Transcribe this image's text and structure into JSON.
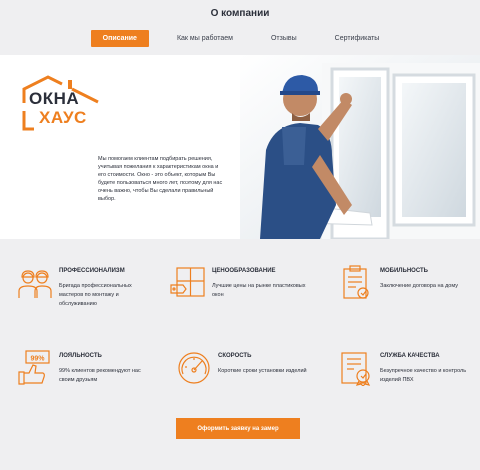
{
  "title": "О компании",
  "tabs": [
    {
      "label": "Описание",
      "active": true
    },
    {
      "label": "Как мы работаем",
      "active": false
    },
    {
      "label": "Отзывы",
      "active": false
    },
    {
      "label": "Сертификаты",
      "active": false
    }
  ],
  "logo": {
    "line1": "ОКНА",
    "line2": "ХАУС"
  },
  "about_text": "Мы помогаем клиентам подбирать решения, учитывая пожелания к характеристикам окна и его стоимости. Окно - это объект, которым Вы будете пользоваться много лет, поэтому для нас очень важно, чтобы Вы сделали правильный выбор.",
  "features": [
    {
      "title": "ПРОФЕССИОНАЛИЗМ",
      "description": "Бригада профессиональных мастеров по монтажу и обслуживанию",
      "icon": "workers-icon"
    },
    {
      "title": "ЦЕНООБРАЗОВАНИЕ",
      "description": "Лучшие цены на рынке пластиковых окон",
      "icon": "window-price-icon"
    },
    {
      "title": "МОБИЛЬНОСТЬ",
      "description": "Заключение договора на дому",
      "icon": "contract-icon"
    },
    {
      "title": "ЛОЯЛЬНОСТЬ",
      "description": "99% клиентов рекомендуют нас своим друзьям",
      "icon": "loyalty-icon",
      "badge": "99%"
    },
    {
      "title": "СКОРОСТЬ",
      "description": "Короткие сроки установки изделий",
      "icon": "speedometer-icon"
    },
    {
      "title": "СЛУЖБА КАЧЕСТВА",
      "description": "Безупречное качество и контроль изделий ПВХ",
      "icon": "quality-icon"
    }
  ],
  "cta_label": "Оформить заявку на замер",
  "colors": {
    "accent": "#ee7f1f",
    "text": "#2b2f3a",
    "background": "#efeff1"
  }
}
